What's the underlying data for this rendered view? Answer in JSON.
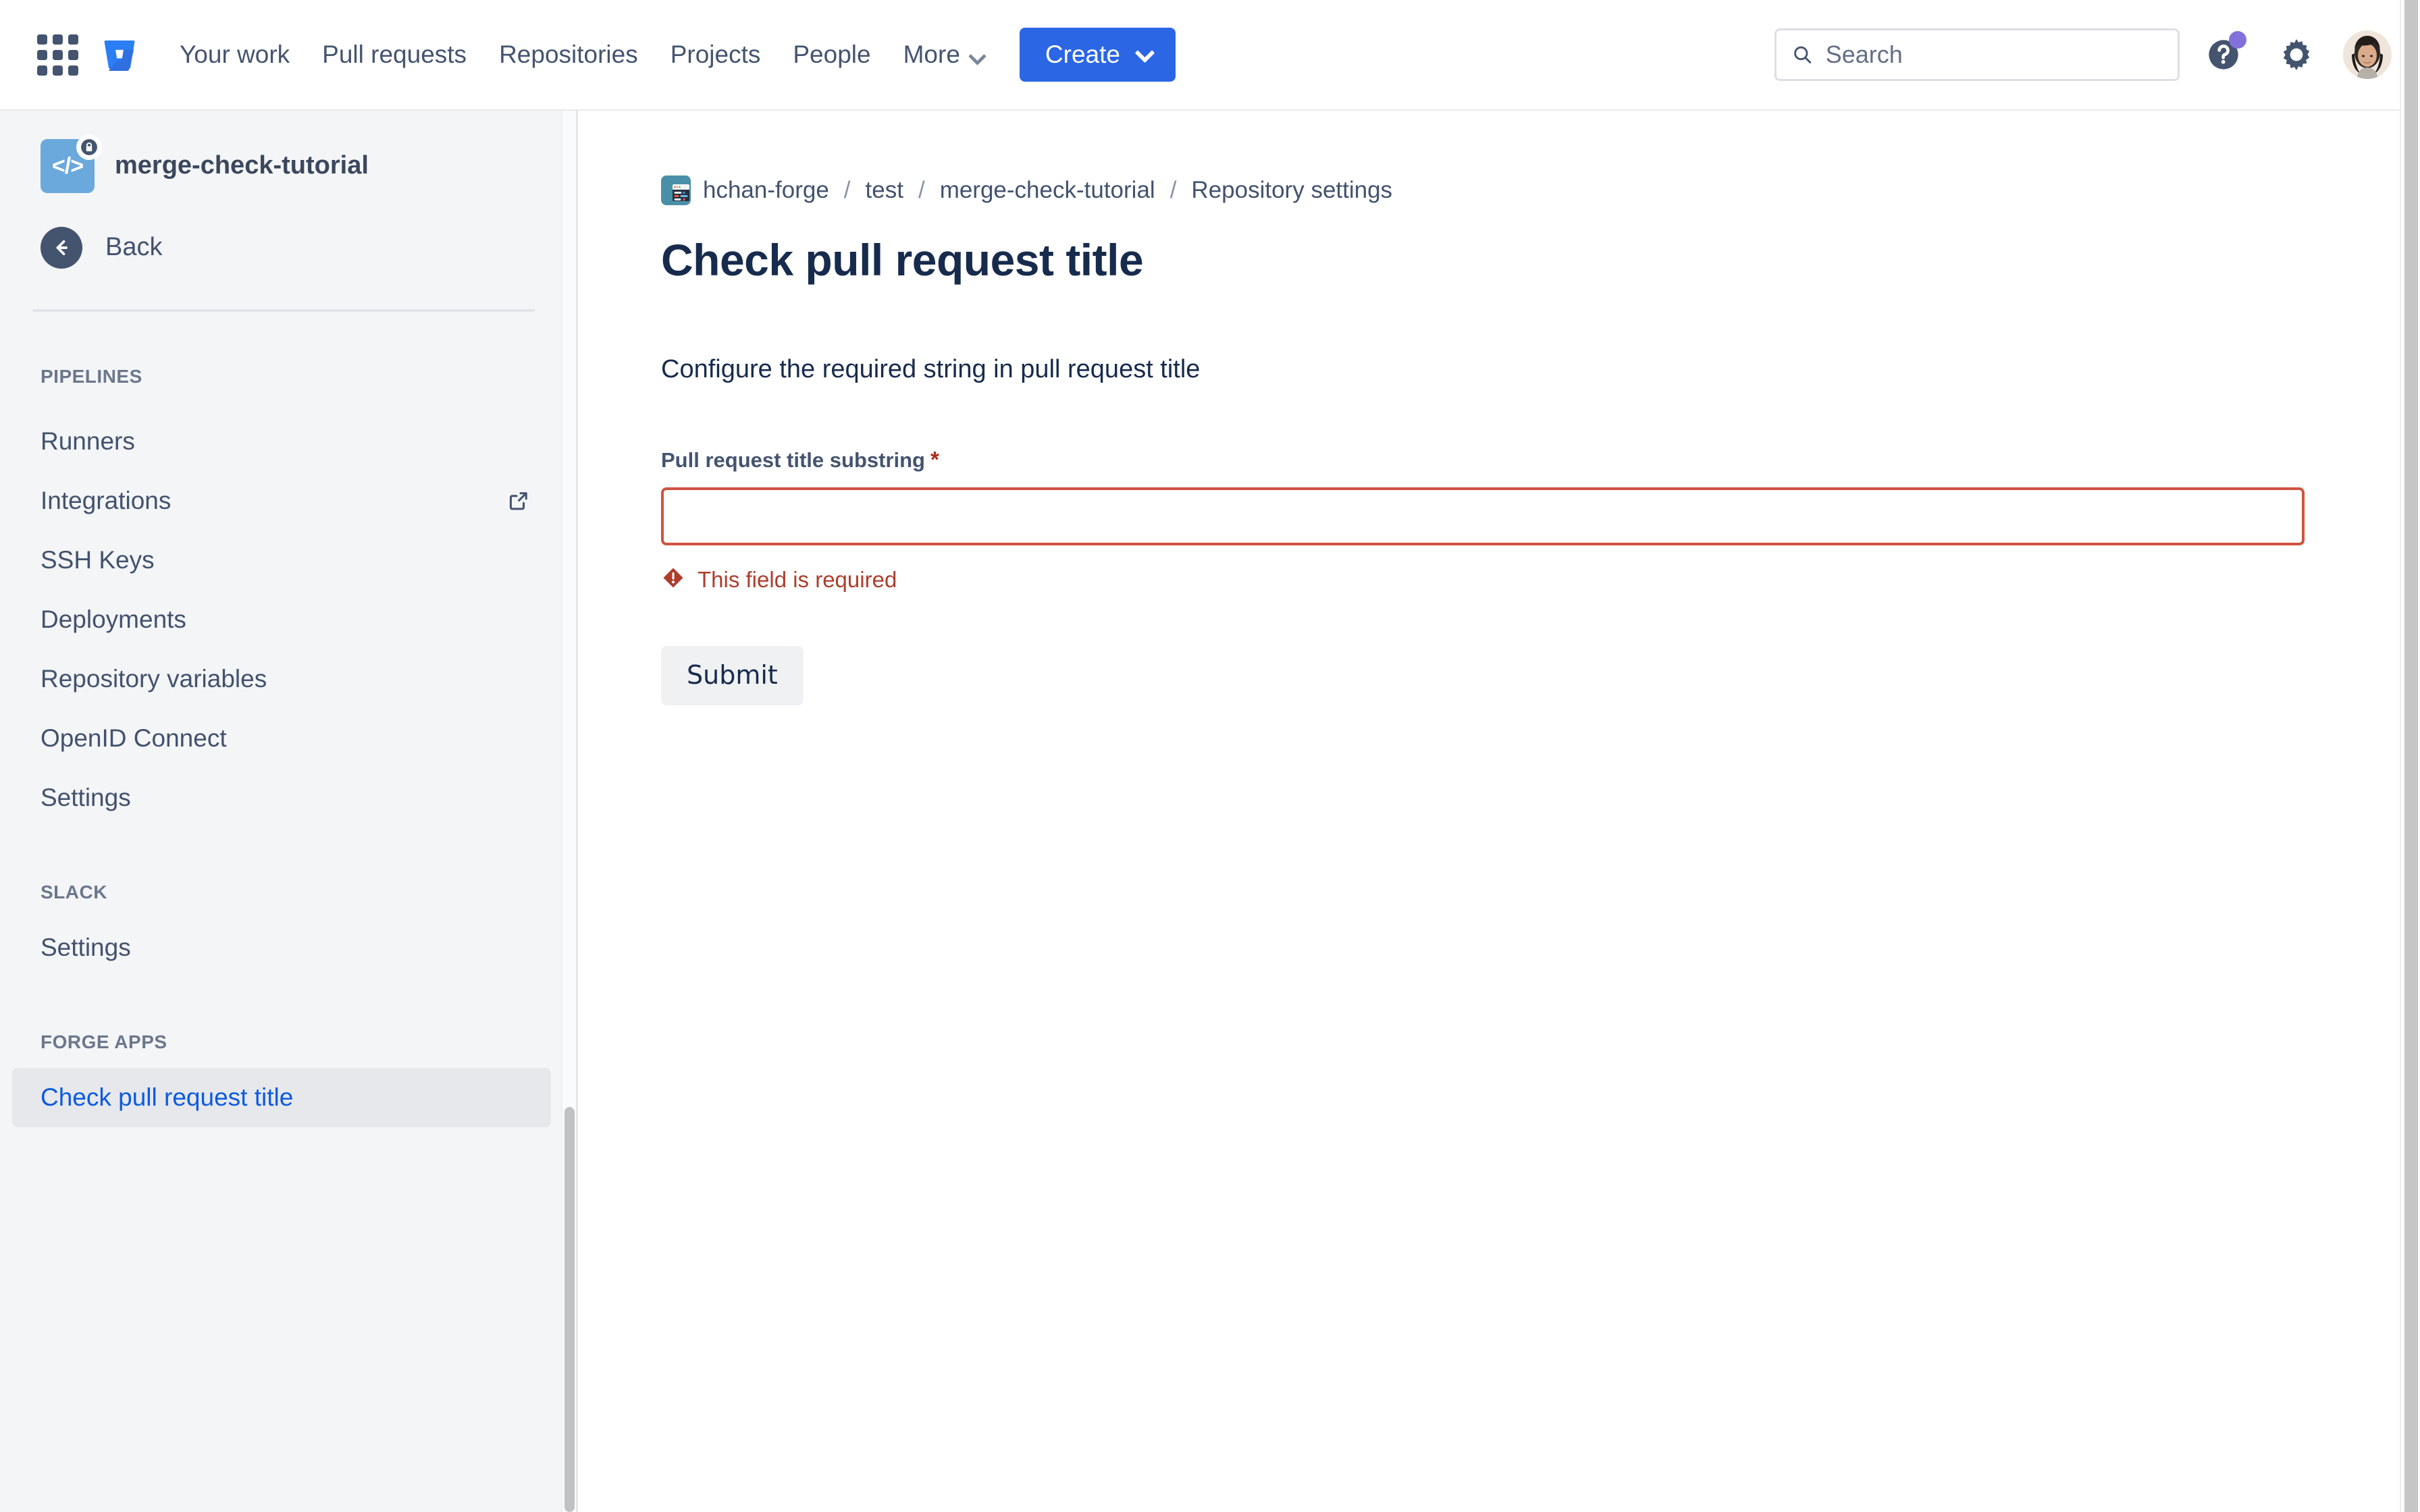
{
  "topnav": {
    "app_switcher_icon": "grid-apps-icon",
    "logo_icon": "bitbucket-logo-icon",
    "links": [
      {
        "label": "Your work",
        "has_chevron": false
      },
      {
        "label": "Pull requests",
        "has_chevron": false
      },
      {
        "label": "Repositories",
        "has_chevron": false
      },
      {
        "label": "Projects",
        "has_chevron": false
      },
      {
        "label": "People",
        "has_chevron": false
      },
      {
        "label": "More",
        "has_chevron": true
      }
    ],
    "create_label": "Create",
    "search": {
      "placeholder": "Search",
      "value": "",
      "icon": "search-icon"
    },
    "help_icon": "help-circle-icon",
    "help_has_notification": true,
    "settings_icon": "gear-icon",
    "avatar_label": "user-avatar"
  },
  "sidebar": {
    "repo_name": "merge-check-tutorial",
    "repo_avatar_glyph": "</>",
    "repo_private_icon": "lock-icon",
    "back_label": "Back",
    "back_icon": "arrow-left-icon",
    "sections": [
      {
        "title": "PIPELINES",
        "items": [
          {
            "label": "Runners",
            "external": false,
            "selected": false
          },
          {
            "label": "Integrations",
            "external": true,
            "selected": false
          },
          {
            "label": "SSH Keys",
            "external": false,
            "selected": false
          },
          {
            "label": "Deployments",
            "external": false,
            "selected": false
          },
          {
            "label": "Repository variables",
            "external": false,
            "selected": false
          },
          {
            "label": "OpenID Connect",
            "external": false,
            "selected": false
          },
          {
            "label": "Settings",
            "external": false,
            "selected": false
          }
        ]
      },
      {
        "title": "SLACK",
        "items": [
          {
            "label": "Settings",
            "external": false,
            "selected": false
          }
        ]
      },
      {
        "title": "FORGE APPS",
        "items": [
          {
            "label": "Check pull request title",
            "external": false,
            "selected": true
          }
        ]
      }
    ]
  },
  "main": {
    "breadcrumb": {
      "workspace_icon": "workspace-avatar-icon",
      "separator": "/",
      "items": [
        "hchan-forge",
        "test",
        "merge-check-tutorial",
        "Repository settings"
      ]
    },
    "page_title": "Check pull request title",
    "description": "Configure the required string in pull request title",
    "form": {
      "field_label": "Pull request title substring",
      "required_marker": "*",
      "input_value": "",
      "input_placeholder": "",
      "error_icon": "error-diamond-icon",
      "error_text": "This field is required",
      "submit_label": "Submit"
    }
  },
  "colors": {
    "brand_blue": "#2b66e4",
    "link_blue": "#0c5ae0",
    "text_dark": "#172b4d",
    "text_muted": "#44546f",
    "error_red": "#cf5340",
    "error_text": "#ae3d2c",
    "sidebar_bg": "#f4f5f7",
    "selected_bg": "#e6e8ec",
    "notification_purple": "#8270db"
  }
}
